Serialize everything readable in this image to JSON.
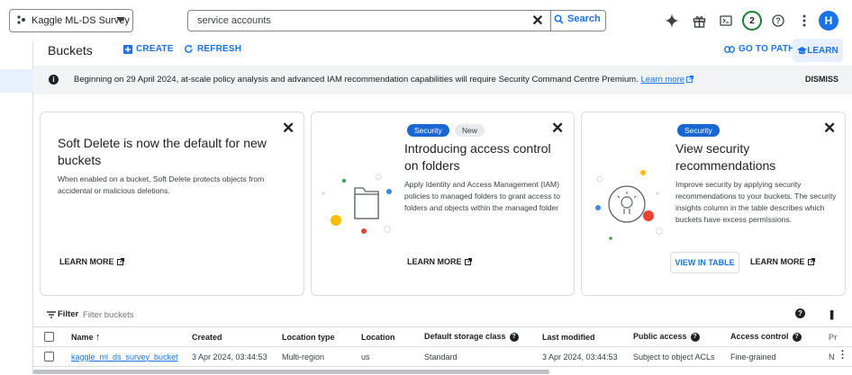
{
  "topbar": {
    "project_name": "Kaggle ML-DS Survey",
    "search_value": "service accounts",
    "search_button": "Search",
    "notification_count": "2",
    "avatar_initial": "H"
  },
  "toolbar": {
    "title": "Buckets",
    "create_label": "CREATE",
    "refresh_label": "REFRESH",
    "go_to_path_label": "GO TO PATH",
    "learn_label": "LEARN"
  },
  "banner": {
    "message": "Beginning on 29 April 2024, at-scale policy analysis and advanced IAM recommendation capabilities will require Security Command Centre Premium.",
    "link": "Learn more",
    "dismiss": "DISMISS"
  },
  "cards": [
    {
      "title": "Soft Delete is now the default for new buckets",
      "body": "When enabled on a bucket, Soft Delete protects objects from accidental or malicious deletions.",
      "learn_more": "LEARN MORE"
    },
    {
      "chips": [
        "Security",
        "New"
      ],
      "title": "Introducing access control on folders",
      "body": "Apply Identity and Access Management (IAM) policies to managed folders to grant access to folders and objects within the managed folder",
      "learn_more": "LEARN MORE"
    },
    {
      "chips": [
        "Security"
      ],
      "title": "View security recommendations",
      "body": "Improve security by applying security recommendations to your buckets. The security insights column in the table describes which buckets have excess permissions.",
      "view_in_table": "VIEW IN TABLE",
      "learn_more": "LEARN MORE"
    }
  ],
  "filter": {
    "label": "Filter",
    "placeholder": "Filter buckets"
  },
  "table": {
    "columns": [
      "Name",
      "Created",
      "Location type",
      "Location",
      "Default storage class",
      "Last modified",
      "Public access",
      "Access control",
      "Pr"
    ],
    "rows": [
      {
        "name": "kaggle_ml_ds_survey_bucket",
        "created": "3 Apr 2024, 03:44:53",
        "location_type": "Multi-region",
        "location": "us",
        "storage_class": "Standard",
        "last_modified": "3 Apr 2024, 03:44:53",
        "public_access": "Subject to object ACLs",
        "access_control": "Fine-grained",
        "protection": "N"
      }
    ]
  },
  "colors": {
    "accent": "#1a73e8",
    "security_chip": "#1967d2",
    "banner_bg": "#f1f3f4",
    "notification_ring": "#188038"
  }
}
